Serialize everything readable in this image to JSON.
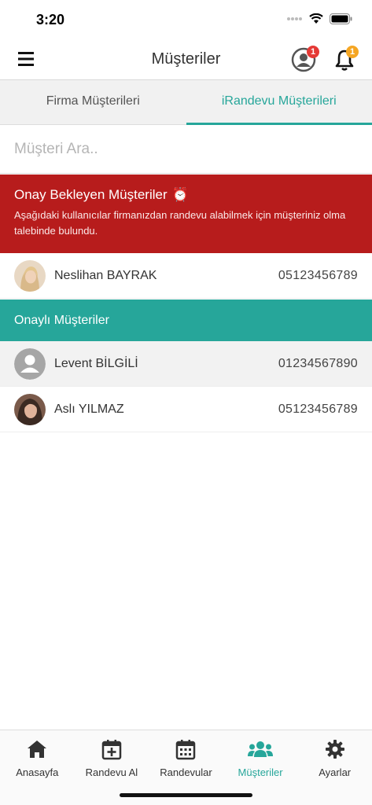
{
  "status": {
    "time": "3:20"
  },
  "header": {
    "title": "Müşteriler",
    "profile_badge": "1",
    "notif_badge": "1"
  },
  "tabs": [
    {
      "label": "Firma Müşterileri",
      "active": false
    },
    {
      "label": "iRandevu Müşterileri",
      "active": true
    }
  ],
  "search": {
    "placeholder": "Müşteri Ara.."
  },
  "pending": {
    "title": "Onay Bekleyen Müşteriler",
    "emoji": "⏰",
    "description": "Aşağıdaki kullanıcılar firmanızdan randevu alabilmek için müşteriniz olma talebinde bulundu.",
    "customers": [
      {
        "name": "Neslihan BAYRAK",
        "phone": "05123456789"
      }
    ]
  },
  "approved": {
    "title": "Onaylı Müşteriler",
    "customers": [
      {
        "name": "Levent BİLGİLİ",
        "phone": "01234567890"
      },
      {
        "name": "Aslı YILMAZ",
        "phone": "05123456789"
      }
    ]
  },
  "bottom_nav": [
    {
      "label": "Anasayfa",
      "icon": "home-icon"
    },
    {
      "label": "Randevu Al",
      "icon": "calendar-plus-icon"
    },
    {
      "label": "Randevular",
      "icon": "calendar-icon"
    },
    {
      "label": "Müşteriler",
      "icon": "users-icon",
      "active": true
    },
    {
      "label": "Ayarlar",
      "icon": "gear-icon"
    }
  ],
  "colors": {
    "accent": "#26a69a",
    "danger": "#b71c1c"
  }
}
